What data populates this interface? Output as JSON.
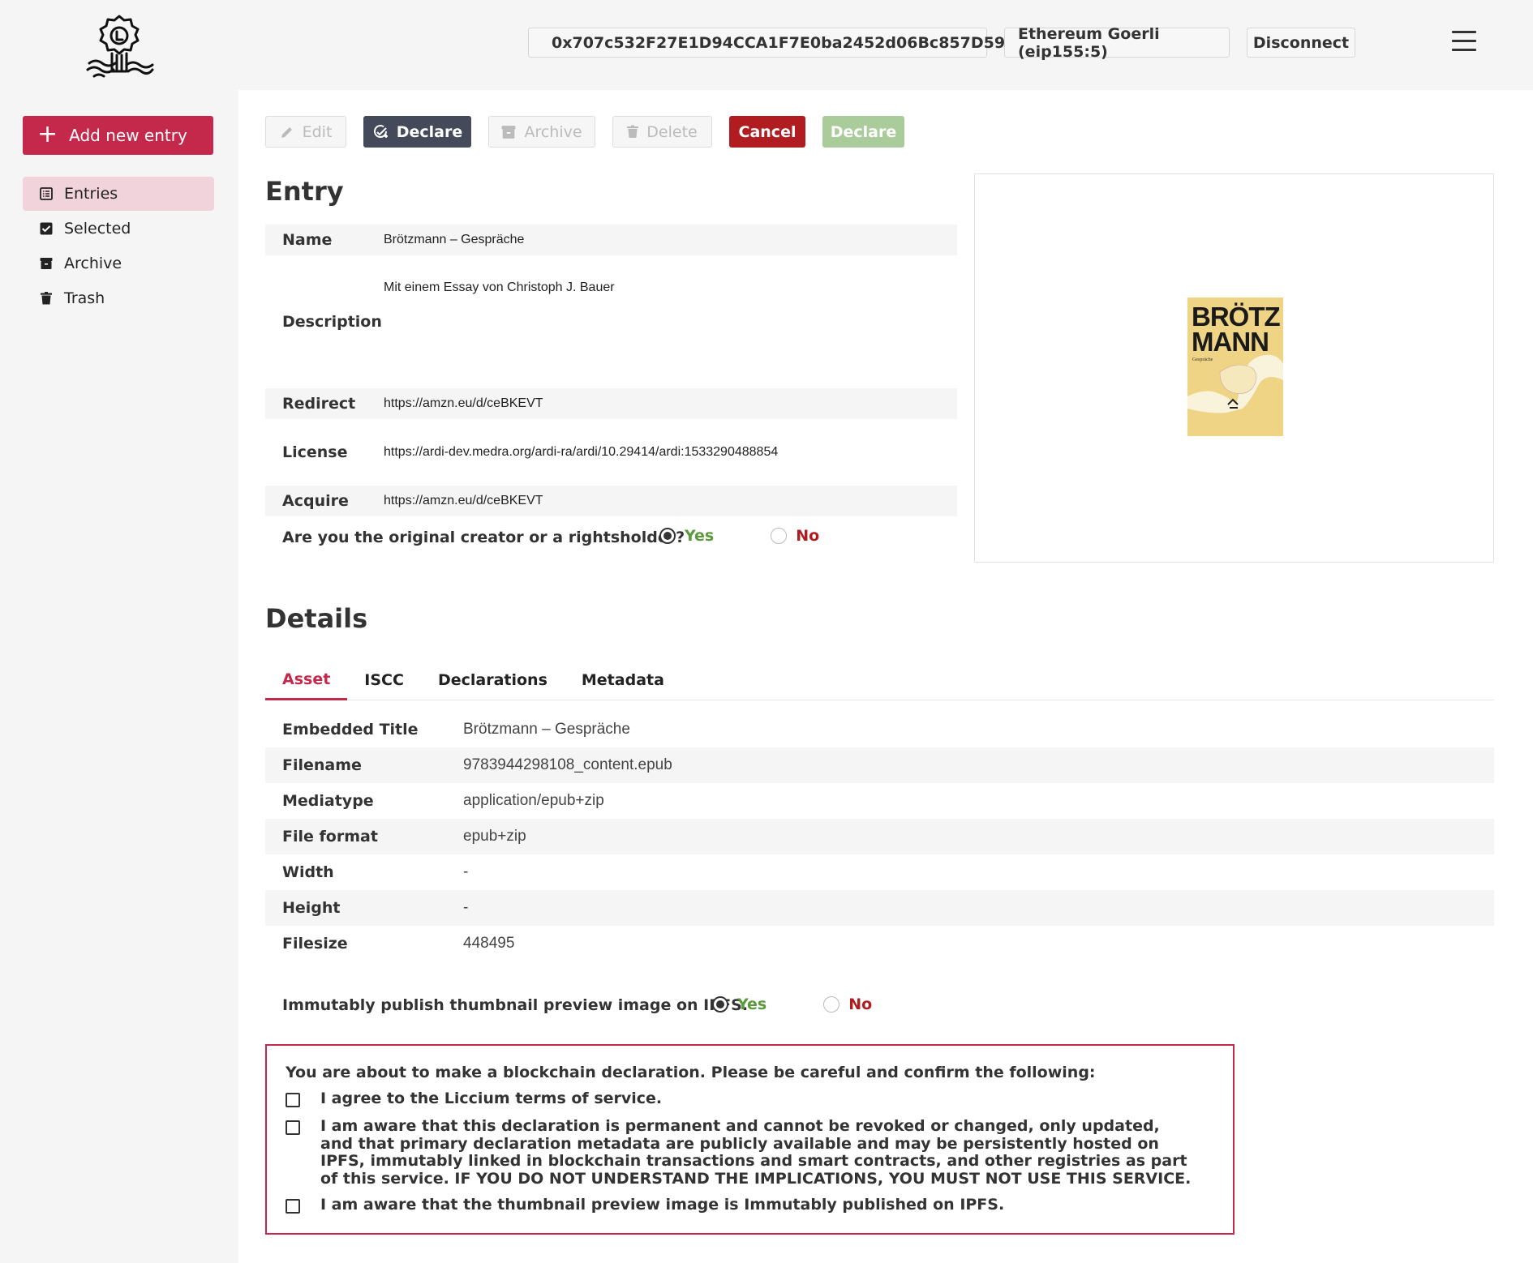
{
  "header": {
    "wallet_address": "0x707c532F27E1D94CCA1F7E0ba2452d06Bc857D59",
    "network": "Ethereum Goerli (eip155:5)",
    "disconnect_label": "Disconnect"
  },
  "sidebar": {
    "add_label": "Add new entry",
    "items": [
      {
        "label": "Entries",
        "icon": "list-icon",
        "active": true
      },
      {
        "label": "Selected",
        "icon": "checkbox-icon",
        "active": false
      },
      {
        "label": "Archive",
        "icon": "archive-icon",
        "active": false
      },
      {
        "label": "Trash",
        "icon": "trash-icon",
        "active": false
      }
    ]
  },
  "toolbar": {
    "edit": "Edit",
    "declare": "Declare",
    "archive": "Archive",
    "delete": "Delete",
    "cancel": "Cancel",
    "declare_confirm": "Declare"
  },
  "entry": {
    "title": "Entry",
    "fields": [
      {
        "label": "Name",
        "value": "Brötzmann – Gespräche"
      },
      {
        "label": "Description",
        "value": "Mit einem Essay von Christoph J. Bauer"
      },
      {
        "label": "Redirect",
        "value": "https://amzn.eu/d/ceBKEVT"
      },
      {
        "label": "License",
        "value": "https://ardi-dev.medra.org/ardi-ra/ardi/10.29414/ardi:1533290488854"
      },
      {
        "label": "Acquire",
        "value": "https://amzn.eu/d/ceBKEVT"
      }
    ],
    "rightsholder_question": "Are you the original creator or a rightsholder?",
    "yes_label": "Yes",
    "no_label": "No",
    "rightsholder_selected": "Yes"
  },
  "cover": {
    "title_line1": "BRÖTZ",
    "title_line2": "MANN",
    "subtitle": "Gespräche"
  },
  "details": {
    "title": "Details",
    "tabs": [
      "Asset",
      "ISCC",
      "Declarations",
      "Metadata"
    ],
    "active_tab": "Asset",
    "asset": [
      {
        "label": "Embedded Title",
        "value": "Brötzmann – Gespräche"
      },
      {
        "label": "Filename",
        "value": "9783944298108_content.epub"
      },
      {
        "label": "Mediatype",
        "value": "application/epub+zip"
      },
      {
        "label": "File format",
        "value": "epub+zip"
      },
      {
        "label": "Width",
        "value": "-"
      },
      {
        "label": "Height",
        "value": "-"
      },
      {
        "label": "Filesize",
        "value": "448495"
      }
    ],
    "publish_question": "Immutably publish thumbnail preview image on IPFS.",
    "publish_selected": "Yes"
  },
  "confirm": {
    "intro": "You are about to make a blockchain declaration. Please be careful and confirm the following:",
    "items": [
      "I agree to the Liccium terms of service.",
      "I am aware that this declaration is permanent and cannot be revoked or changed, only updated, and that primary declaration metadata are publicly available and may be persistently hosted on IPFS, immutably linked in blockchain transactions and smart contracts, and other registries as part of this service. IF YOU DO NOT UNDERSTAND THE IMPLICATIONS, YOU MUST NOT USE THIS SERVICE.",
      "I am aware that the thumbnail preview image is Immutably published on IPFS."
    ]
  },
  "colors": {
    "brand": "#c4284a",
    "cancel": "#b11c20",
    "declare_dark": "#444a5a",
    "declare_disabled": "#a9cc9a",
    "yes": "#5a9a3a"
  }
}
